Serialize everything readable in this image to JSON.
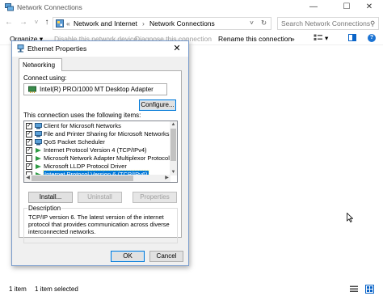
{
  "explorer": {
    "title": "Network Connections",
    "window_buttons": {
      "minimize": "—",
      "maximize": "☐",
      "close": "✕"
    },
    "nav": {
      "back": "←",
      "forward": "→",
      "recent": "˅",
      "up": "↑"
    },
    "address": {
      "sep": "«",
      "crumb1": "Network and Internet",
      "arrow1": "›",
      "crumb2": "Network Connections",
      "dropdown": "˅",
      "refresh": "↻"
    },
    "search": {
      "placeholder": "Search Network Connections",
      "icon": "⚲"
    },
    "command_bar": {
      "organize": "Organize ▾",
      "disable": "Disable this network device",
      "diagnose": "Diagnose this connection",
      "rename": "Rename this connection",
      "more": "»",
      "view": "▾",
      "help": "?"
    },
    "status": {
      "count": "1 item",
      "selected": "1 item selected"
    }
  },
  "dialog": {
    "title": "Ethernet Properties",
    "close": "✕",
    "tab": "Networking",
    "connect_using_label": "Connect using:",
    "adapter": "Intel(R) PRO/1000 MT Desktop Adapter",
    "configure_button": "Configure...",
    "items_label": "This connection uses the following items:",
    "items": [
      {
        "checked": true,
        "label": "Client for Microsoft Networks",
        "icon": "network-client-icon"
      },
      {
        "checked": true,
        "label": "File and Printer Sharing for Microsoft Networks",
        "icon": "service-icon"
      },
      {
        "checked": true,
        "label": "QoS Packet Scheduler",
        "icon": "service-icon"
      },
      {
        "checked": true,
        "label": "Internet Protocol Version 4 (TCP/IPv4)",
        "icon": "protocol-icon"
      },
      {
        "checked": false,
        "label": "Microsoft Network Adapter Multiplexor Protocol",
        "icon": "protocol-icon"
      },
      {
        "checked": true,
        "label": "Microsoft LLDP Protocol Driver",
        "icon": "protocol-icon"
      },
      {
        "checked": false,
        "label": "Internet Protocol Version 6 (TCP/IPv6)",
        "icon": "protocol-icon",
        "selected": true
      }
    ],
    "install_button": "Install...",
    "uninstall_button": "Uninstall",
    "properties_button": "Properties",
    "description_label": "Description",
    "description_text": "TCP/IP version 6. The latest version of the internet protocol that provides communication across diverse interconnected networks.",
    "ok_button": "OK",
    "cancel_button": "Cancel",
    "check_glyph": "✓"
  },
  "colors": {
    "accent": "#0078d7",
    "dialog_bg": "#f0f0f0"
  }
}
